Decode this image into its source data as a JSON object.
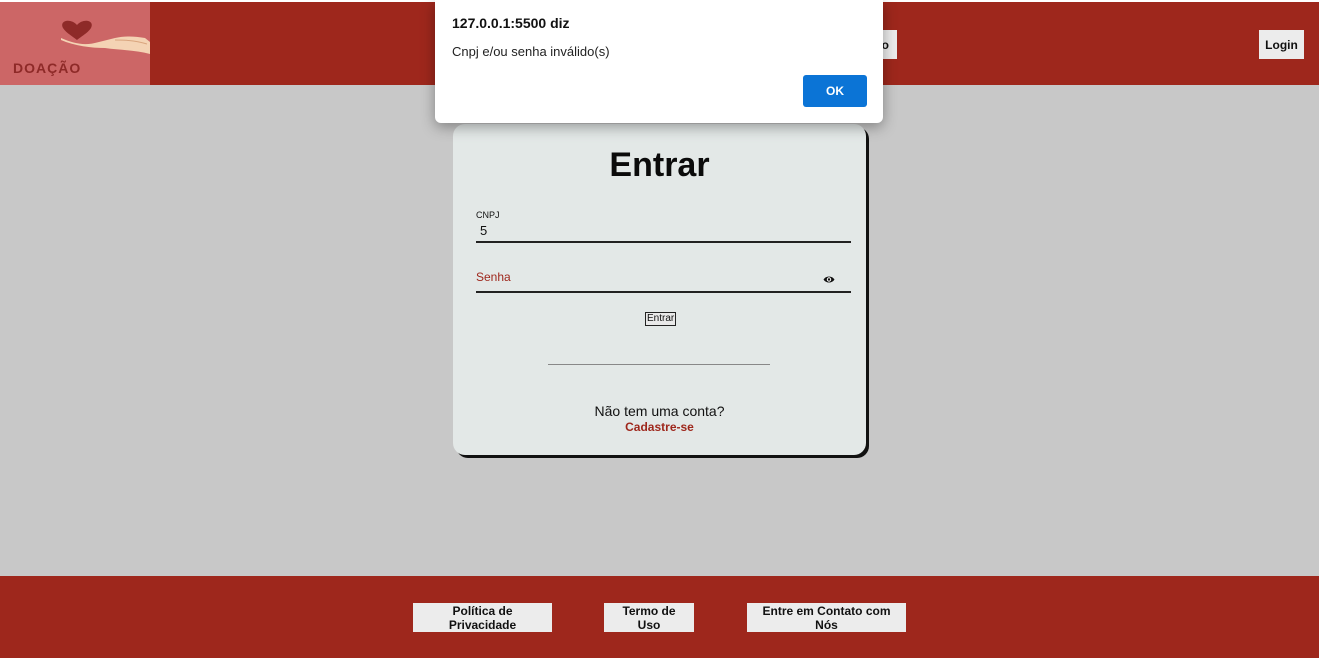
{
  "header": {
    "logo_text": "DOAÇÃO",
    "partial_button_label": "o",
    "login_label": "Login"
  },
  "dialog": {
    "title": "127.0.0.1:5500 diz",
    "message": "Cnpj e/ou senha inválido(s)",
    "ok_label": "OK"
  },
  "card": {
    "title": "Entrar",
    "cnpj_label": "CNPJ",
    "cnpj_value": "5",
    "senha_label": "Senha",
    "submit_label": "Entrar",
    "signup_question": "Não tem uma conta?",
    "signup_link": "Cadastre-se"
  },
  "footer": {
    "links": [
      {
        "label": "Política de Privacidade"
      },
      {
        "label": "Termo de Uso"
      },
      {
        "label": "Entre em Contato com Nós"
      }
    ]
  },
  "colors": {
    "brand_red": "#9e271c",
    "dialog_button": "#0b74d6",
    "background": "#c8c8c8"
  }
}
